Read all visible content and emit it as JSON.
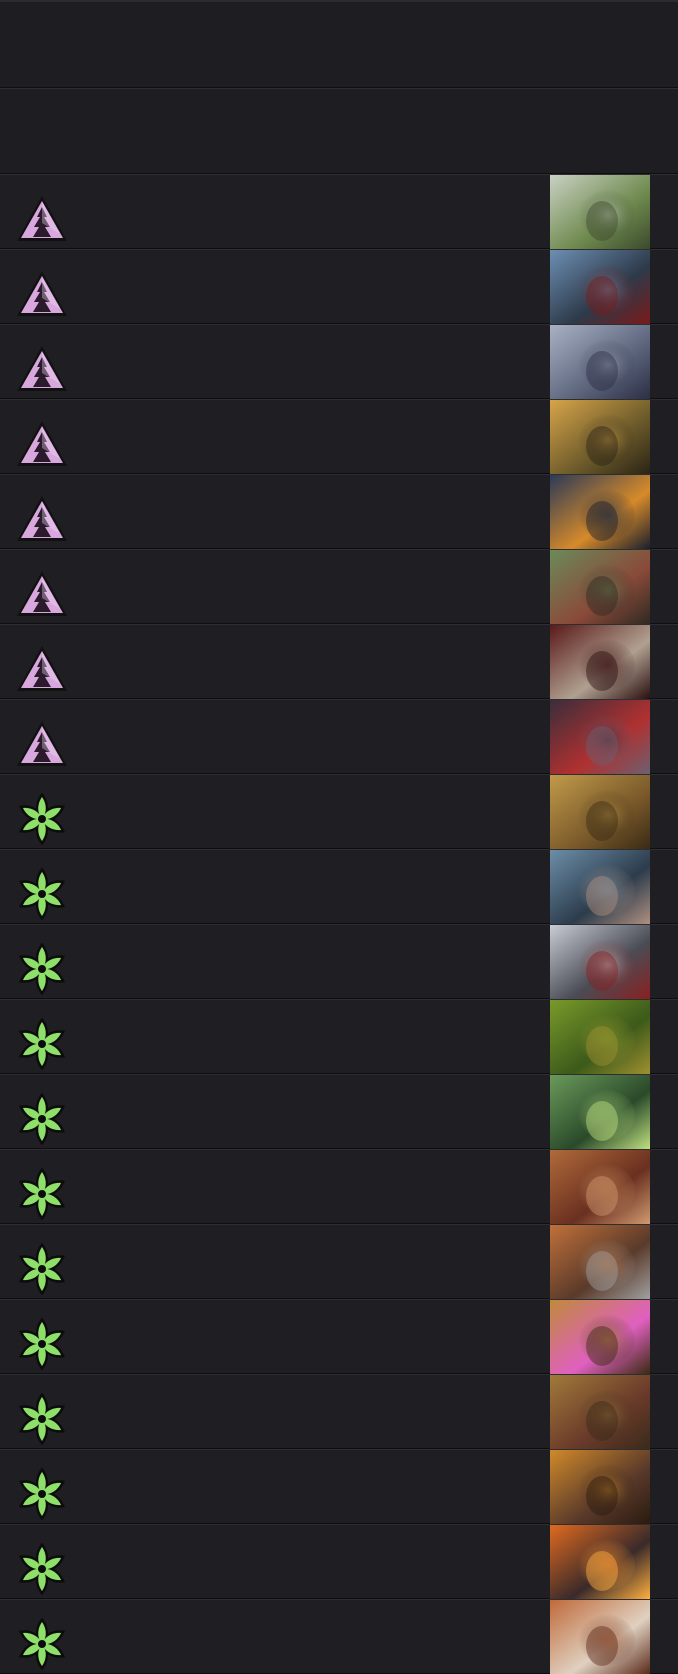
{
  "header": {
    "rows": [
      "",
      ""
    ]
  },
  "colors": {
    "background": "#1f1f23",
    "divider": "#0e0e10",
    "shadow_faction": "#d7a7dd",
    "nature_faction": "#8ee06a"
  },
  "cards": [
    {
      "faction": "shadow",
      "icon": "triangle-faction-icon",
      "art": [
        "#c9d1c2",
        "#6f8a4f",
        "#3b4a2c"
      ]
    },
    {
      "faction": "shadow",
      "icon": "triangle-faction-icon",
      "art": [
        "#6d8fb3",
        "#2d3a4a",
        "#7a1a1a"
      ]
    },
    {
      "faction": "shadow",
      "icon": "triangle-faction-icon",
      "art": [
        "#a9b2c4",
        "#5c657c",
        "#2c2f45"
      ]
    },
    {
      "faction": "shadow",
      "icon": "triangle-faction-icon",
      "art": [
        "#d7a44a",
        "#6b5a2a",
        "#2b2416"
      ]
    },
    {
      "faction": "shadow",
      "icon": "triangle-faction-icon",
      "art": [
        "#2b3a57",
        "#d68a2a",
        "#1a1f2c"
      ]
    },
    {
      "faction": "shadow",
      "icon": "triangle-faction-icon",
      "art": [
        "#6b8a5a",
        "#8a4a3a",
        "#2f2a22"
      ]
    },
    {
      "faction": "shadow",
      "icon": "triangle-faction-icon",
      "art": [
        "#5a1a1a",
        "#b0a090",
        "#2a0f0f"
      ]
    },
    {
      "faction": "shadow",
      "icon": "triangle-faction-icon",
      "art": [
        "#3a2e3a",
        "#b03030",
        "#6c6070"
      ]
    },
    {
      "faction": "nature",
      "icon": "leaf-faction-icon",
      "art": [
        "#c09a4a",
        "#7a5a2a",
        "#3a2a15"
      ]
    },
    {
      "faction": "nature",
      "icon": "leaf-faction-icon",
      "art": [
        "#6c8ea8",
        "#2c3c4c",
        "#b09080"
      ]
    },
    {
      "faction": "nature",
      "icon": "leaf-faction-icon",
      "art": [
        "#c8ccd4",
        "#4a4c55",
        "#8a2020"
      ]
    },
    {
      "faction": "nature",
      "icon": "leaf-faction-icon",
      "art": [
        "#7a9a2a",
        "#3c5a1a",
        "#a09030"
      ]
    },
    {
      "faction": "nature",
      "icon": "leaf-faction-icon",
      "art": [
        "#6a9a5a",
        "#2a4a2a",
        "#c0e080"
      ]
    },
    {
      "faction": "nature",
      "icon": "leaf-faction-icon",
      "art": [
        "#b06a3a",
        "#6a3020",
        "#d09a70"
      ]
    },
    {
      "faction": "nature",
      "icon": "leaf-faction-icon",
      "art": [
        "#c0703a",
        "#5a3a2a",
        "#a0a0a0"
      ]
    },
    {
      "faction": "nature",
      "icon": "leaf-faction-icon",
      "art": [
        "#c08a3a",
        "#e060c0",
        "#3a2a10"
      ]
    },
    {
      "faction": "nature",
      "icon": "leaf-faction-icon",
      "art": [
        "#a07a3a",
        "#6a3a2a",
        "#3a2a1a"
      ]
    },
    {
      "faction": "nature",
      "icon": "leaf-faction-icon",
      "art": [
        "#d08a2a",
        "#5a3a2a",
        "#2a1a10"
      ]
    },
    {
      "faction": "nature",
      "icon": "leaf-faction-icon",
      "art": [
        "#e06a20",
        "#3a2a2a",
        "#ffb040"
      ]
    },
    {
      "faction": "nature",
      "icon": "leaf-faction-icon",
      "art": [
        "#c06a3a",
        "#e0d0c0",
        "#5a2a1a"
      ]
    }
  ]
}
